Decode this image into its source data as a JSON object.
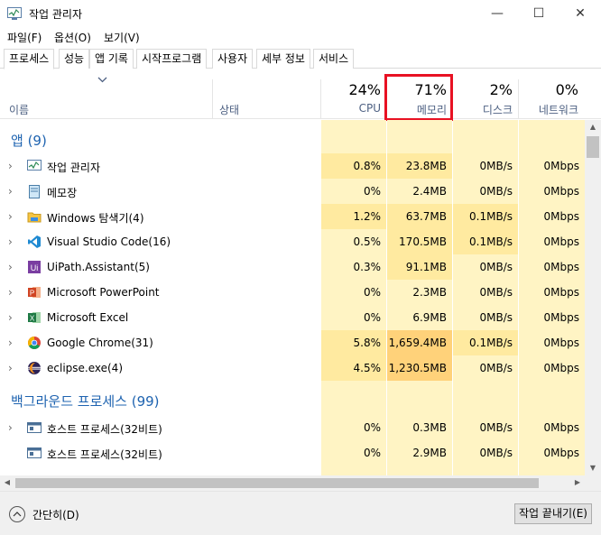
{
  "window": {
    "title": "작업 관리자",
    "controls": {
      "minimize": "—",
      "maximize": "☐",
      "close": "✕"
    }
  },
  "menu": [
    {
      "label": "파일(F)"
    },
    {
      "label": "옵션(O)"
    },
    {
      "label": "보기(V)"
    }
  ],
  "tabs": [
    {
      "label": "프로세스",
      "active": true
    },
    {
      "label": "성능"
    },
    {
      "label": "앱 기록"
    },
    {
      "label": "시작프로그램"
    },
    {
      "label": "사용자"
    },
    {
      "label": "세부 정보"
    },
    {
      "label": "서비스"
    }
  ],
  "columns": {
    "name": "이름",
    "status": "상태",
    "cpu": {
      "pct": "24%",
      "label": "CPU"
    },
    "memory": {
      "pct": "71%",
      "label": "메모리"
    },
    "disk": {
      "pct": "2%",
      "label": "디스크"
    },
    "network": {
      "pct": "0%",
      "label": "네트워크"
    }
  },
  "groups": {
    "apps": "앱 (9)",
    "background": "백그라운드 프로세스 (99)"
  },
  "apps": [
    {
      "name": "작업 관리자",
      "icon": "task-manager-icon",
      "cpu": "0.8%",
      "memory": "23.8MB",
      "disk": "0MB/s",
      "network": "0Mbps"
    },
    {
      "name": "메모장",
      "icon": "notepad-icon",
      "cpu": "0%",
      "memory": "2.4MB",
      "disk": "0MB/s",
      "network": "0Mbps"
    },
    {
      "name": "Windows 탐색기(4)",
      "icon": "folder-icon",
      "cpu": "1.2%",
      "memory": "63.7MB",
      "disk": "0.1MB/s",
      "network": "0Mbps"
    },
    {
      "name": "Visual Studio Code(16)",
      "icon": "vscode-icon",
      "cpu": "0.5%",
      "memory": "170.5MB",
      "disk": "0.1MB/s",
      "network": "0Mbps"
    },
    {
      "name": "UiPath.Assistant(5)",
      "icon": "uipath-icon",
      "cpu": "0.3%",
      "memory": "91.1MB",
      "disk": "0MB/s",
      "network": "0Mbps"
    },
    {
      "name": "Microsoft PowerPoint",
      "icon": "powerpoint-icon",
      "cpu": "0%",
      "memory": "2.3MB",
      "disk": "0MB/s",
      "network": "0Mbps"
    },
    {
      "name": "Microsoft Excel",
      "icon": "excel-icon",
      "cpu": "0%",
      "memory": "6.9MB",
      "disk": "0MB/s",
      "network": "0Mbps"
    },
    {
      "name": "Google Chrome(31)",
      "icon": "chrome-icon",
      "cpu": "5.8%",
      "memory": "1,659.4MB",
      "disk": "0.1MB/s",
      "network": "0Mbps"
    },
    {
      "name": "eclipse.exe(4)",
      "icon": "eclipse-icon",
      "cpu": "4.5%",
      "memory": "1,230.5MB",
      "disk": "0MB/s",
      "network": "0Mbps"
    }
  ],
  "background": [
    {
      "name": "호스트 프로세스(32비트)",
      "icon": "host-process-icon",
      "cpu": "0%",
      "memory": "0.3MB",
      "disk": "0MB/s",
      "network": "0Mbps"
    },
    {
      "name": "호스트 프로세스(32비트)",
      "icon": "host-process-icon",
      "cpu": "0%",
      "memory": "2.9MB",
      "disk": "0MB/s",
      "network": "0Mbps"
    }
  ],
  "footer": {
    "collapse": "간단히(D)",
    "end_task": "작업 끝내기(E)"
  },
  "colors": {
    "accent": "#1e63b0",
    "highlight": "#e81123",
    "heat_light": "#fff4c4",
    "heat_mid": "#ffeaa0",
    "heat_strong": "#ffd27a"
  }
}
